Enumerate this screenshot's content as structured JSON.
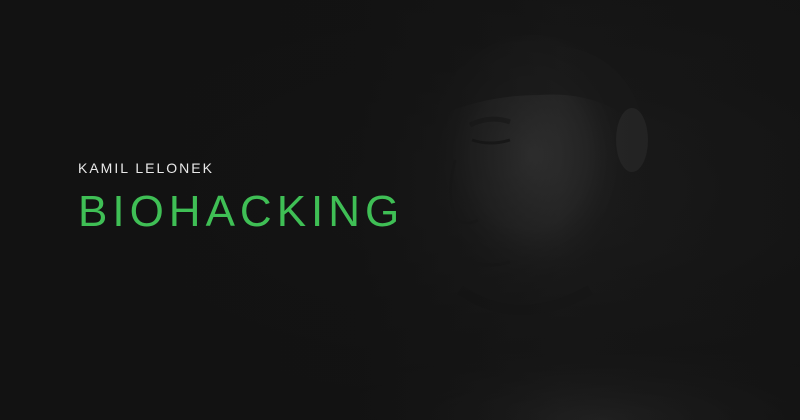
{
  "cover": {
    "author": "KAMIL LELONEK",
    "title": "BIOHACKING"
  },
  "colors": {
    "background": "#141414",
    "accent": "#3fbf55",
    "author_text": "#e8e8e8"
  },
  "image": {
    "subject": "face-portrait-icon"
  }
}
